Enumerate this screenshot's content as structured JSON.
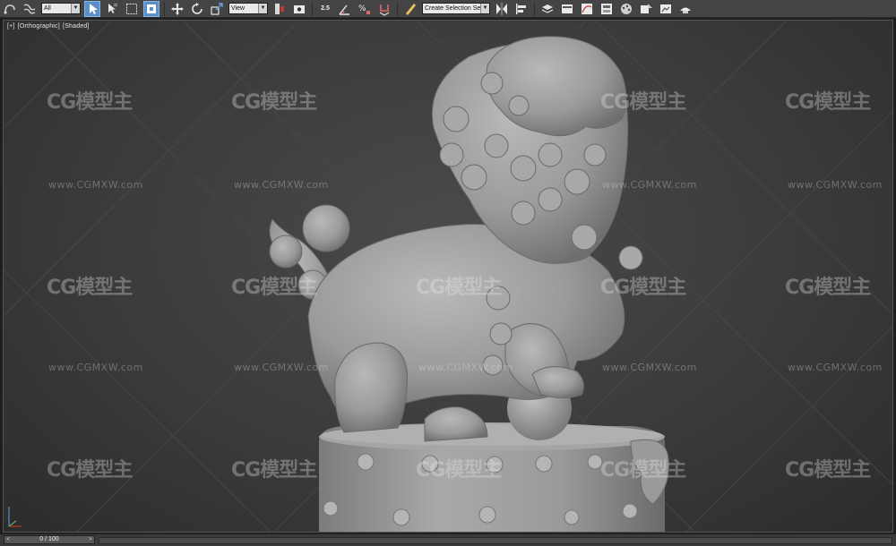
{
  "toolbar": {
    "selection_filter": "All",
    "reference_coord": "View",
    "snap_label": "2.5",
    "named_selection_placeholder": "Create Selection Se",
    "icons": [
      "undo-icon",
      "redo-icon",
      "select-link-icon",
      "unlink-icon",
      "bind-spacewarp-icon",
      "select-object-icon",
      "select-by-name-icon",
      "rect-selection-icon",
      "window-crossing-icon",
      "move-icon",
      "rotate-icon",
      "scale-icon",
      "pivot-icon",
      "keyboard-shortcut-icon",
      "snap-toggle-icon",
      "angle-snap-icon",
      "percent-snap-icon",
      "spinner-snap-icon",
      "edit-named-selection-icon",
      "mirror-icon",
      "align-icon",
      "layer-manager-icon",
      "ribbon-icon",
      "curve-editor-icon",
      "schematic-view-icon",
      "material-editor-icon",
      "render-setup-icon",
      "rendered-frame-icon",
      "render-icon"
    ]
  },
  "viewport": {
    "label_plus": "[+]",
    "label_view": "[Orthographic]",
    "label_shading": "[Shaded]"
  },
  "watermark": {
    "logo": "CG模型主",
    "url": "www.CGMXW.com"
  },
  "timeline": {
    "frame_display": "0 / 100",
    "prev": "<",
    "next": ">"
  },
  "colors": {
    "toolbar_bg": "#444444",
    "viewport_bg": "#3b3b3b",
    "model": "#9c9c9c",
    "active_button": "#5b8fc9"
  }
}
